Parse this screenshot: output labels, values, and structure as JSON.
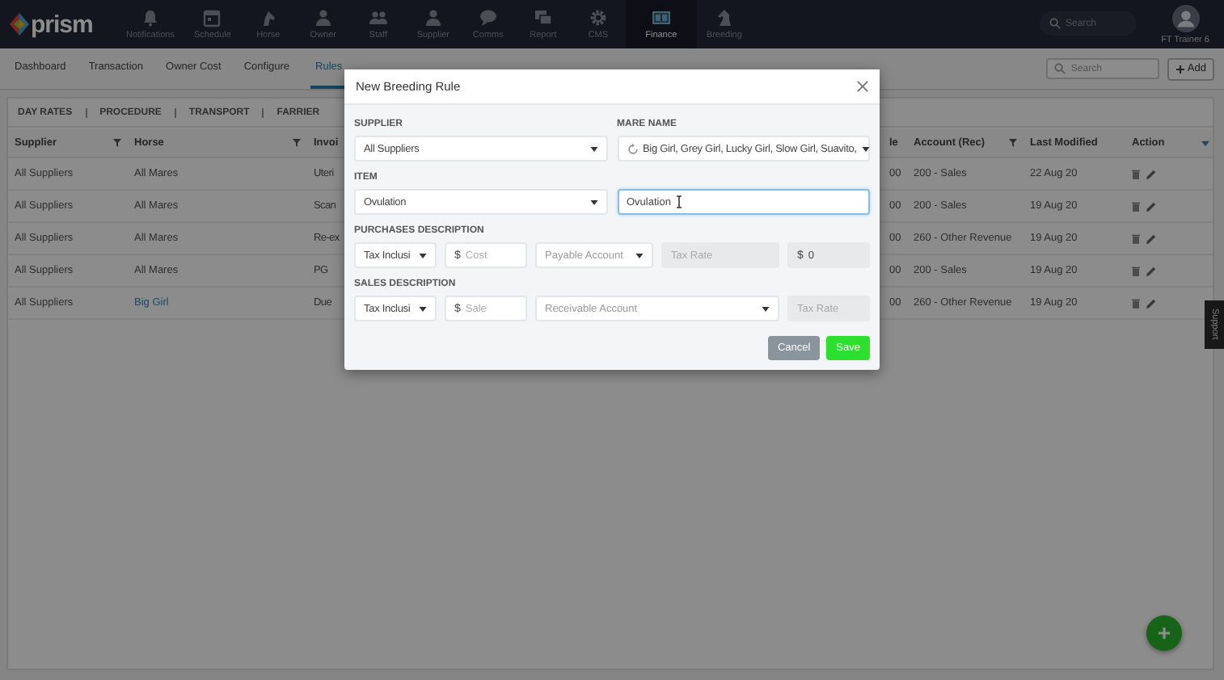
{
  "top_nav": {
    "logo": "prism",
    "items": [
      {
        "label": "Notifications",
        "selected": false
      },
      {
        "label": "Schedule",
        "selected": false
      },
      {
        "label": "Horse",
        "selected": false
      },
      {
        "label": "Owner",
        "selected": false
      },
      {
        "label": "Staff",
        "selected": false
      },
      {
        "label": "Supplier",
        "selected": false
      },
      {
        "label": "Comms",
        "selected": false
      },
      {
        "label": "Report",
        "selected": false
      },
      {
        "label": "CMS",
        "selected": false
      },
      {
        "label": "Finance",
        "selected": true
      },
      {
        "label": "Breeding",
        "selected": false
      }
    ],
    "search": {
      "placeholder": "Search"
    },
    "user": "FT Trainer 6"
  },
  "sub_nav": {
    "items": [
      {
        "label": "Dashboard",
        "selected": false
      },
      {
        "label": "Transaction",
        "selected": false
      },
      {
        "label": "Owner Cost",
        "selected": false
      },
      {
        "label": "Configure",
        "selected": false
      },
      {
        "label": "Rules",
        "selected": true
      }
    ],
    "search": {
      "placeholder": "Search"
    },
    "add_button": "Add"
  },
  "rule_tabs": [
    "DAY RATES",
    "PROCEDURE",
    "TRANSPORT",
    "FARRIER"
  ],
  "table": {
    "columns": [
      {
        "label": "Supplier",
        "filter": true
      },
      {
        "label": "Horse",
        "filter": true
      },
      {
        "label": "Invoi",
        "filter": false
      },
      {
        "label": "le",
        "filter": false
      },
      {
        "label": "Account (Rec)",
        "filter": true
      },
      {
        "label": "Last Modified",
        "filter": false
      },
      {
        "label": "Action",
        "filter": false
      }
    ],
    "rows": [
      {
        "cells": [
          "All Suppliers",
          "All Mares",
          "Uteri",
          "00",
          "200 - Sales",
          "22 Aug 20"
        ],
        "horse_link": false
      },
      {
        "cells": [
          "All Suppliers",
          "All Mares",
          "Scan",
          "00",
          "200 - Sales",
          "19 Aug 20"
        ],
        "horse_link": false
      },
      {
        "cells": [
          "All Suppliers",
          "All Mares",
          "Re-ex",
          "00",
          "260 - Other Revenue",
          "19 Aug 20"
        ],
        "horse_link": false
      },
      {
        "cells": [
          "All Suppliers",
          "All Mares",
          "PG",
          "00",
          "200 - Sales",
          "19 Aug 20"
        ],
        "horse_link": false
      },
      {
        "cells": [
          "All Suppliers",
          "Big Girl",
          "Due",
          "00",
          "260 - Other Revenue",
          "19 Aug 20"
        ],
        "horse_link": true
      }
    ]
  },
  "support_tab": "Support",
  "dialog": {
    "title": "New Breeding Rule",
    "supplier": {
      "label": "SUPPLIER",
      "value": "All Suppliers"
    },
    "mare_name": {
      "label": "MARE NAME",
      "value": "Big Girl, Grey Girl, Lucky Girl, Slow Girl, Suavito,"
    },
    "item": {
      "label": "ITEM",
      "value": "Ovulation",
      "description": "Ovulation"
    },
    "sections": [
      {
        "label": "PURCHASES DESCRIPTION",
        "fields": [
          {
            "kind": "select",
            "value": "Tax Inclusi",
            "disabled": false
          },
          {
            "kind": "money",
            "prefix": "$",
            "placeholder": "Cost",
            "disabled": false
          },
          {
            "kind": "select",
            "placeholder": "Payable Account",
            "disabled": false
          },
          {
            "kind": "text",
            "placeholder": "Tax Rate",
            "disabled": true
          },
          {
            "kind": "money",
            "prefix": "$",
            "value": "0",
            "disabled": true
          }
        ]
      },
      {
        "label": "SALES DESCRIPTION",
        "fields": [
          {
            "kind": "select",
            "value": "Tax Inclusi",
            "disabled": false
          },
          {
            "kind": "money",
            "prefix": "$",
            "placeholder": "Sale",
            "disabled": false
          },
          {
            "kind": "select",
            "placeholder": "Receivable Account",
            "disabled": false
          },
          {
            "kind": "text",
            "placeholder": "Tax Rate",
            "disabled": true
          }
        ]
      }
    ],
    "buttons": [
      {
        "label": "Cancel",
        "kind": "secondary"
      },
      {
        "label": "Save",
        "kind": "primary"
      }
    ]
  }
}
